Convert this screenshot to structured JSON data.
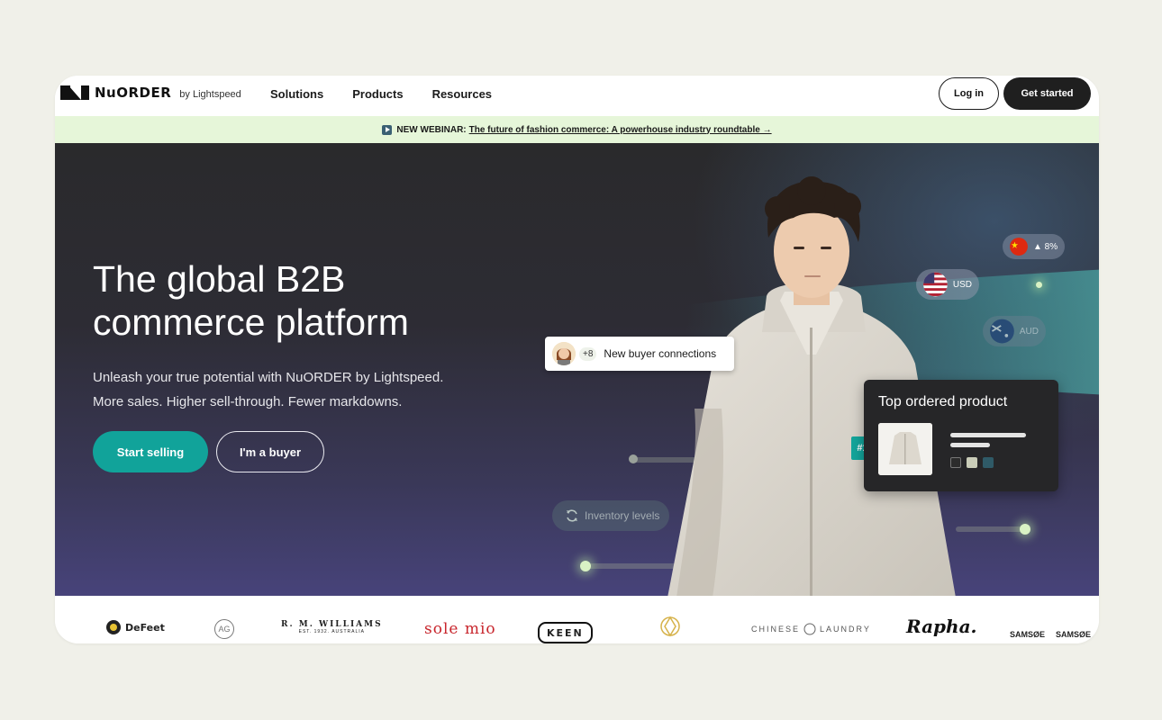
{
  "nav": {
    "brand": "NuORDER",
    "brand_sub": "by Lightspeed",
    "links": [
      "Solutions",
      "Products",
      "Resources"
    ],
    "login_label": "Log in",
    "get_started_label": "Get started"
  },
  "banner": {
    "label": "NEW WEBINAR:",
    "link_text": "The future of fashion commerce: A powerhouse industry roundtable →"
  },
  "hero": {
    "title_line1": "The global B2B",
    "title_line2": "commerce platform",
    "desc_line1": "Unleash your true potential with NuORDER by Lightspeed.",
    "desc_line2": "More sales. Higher sell-through. Fewer markdowns.",
    "start_selling_label": "Start selling",
    "buyer_label": "I'm a buyer"
  },
  "widgets": {
    "buyer_count": "+8",
    "buyer_text": "New buyer connections",
    "cny_change": "▲ 8%",
    "usd_label": "USD",
    "aud_label": "AUD",
    "inventory_label": "Inventory levels",
    "top_product_title": "Top ordered product",
    "rank": "#1",
    "swatch_colors": [
      "#2c2c2c",
      "#c9ccb8",
      "#2f5a67"
    ]
  },
  "logos": [
    "DeFeet",
    "AG",
    "R. M. WILLIAMS",
    "EST. 1932. AUSTRALIA",
    "sole mio",
    "KEEN",
    "CHINESE",
    "LAUNDRY",
    "Rapha.",
    "SAMSØE",
    "SAMSØE"
  ],
  "colors": {
    "accent": "#11a39a",
    "banner_bg": "#e6f6d9",
    "hero_dark": "#2a2a2c",
    "hero_purple": "#47437a"
  }
}
